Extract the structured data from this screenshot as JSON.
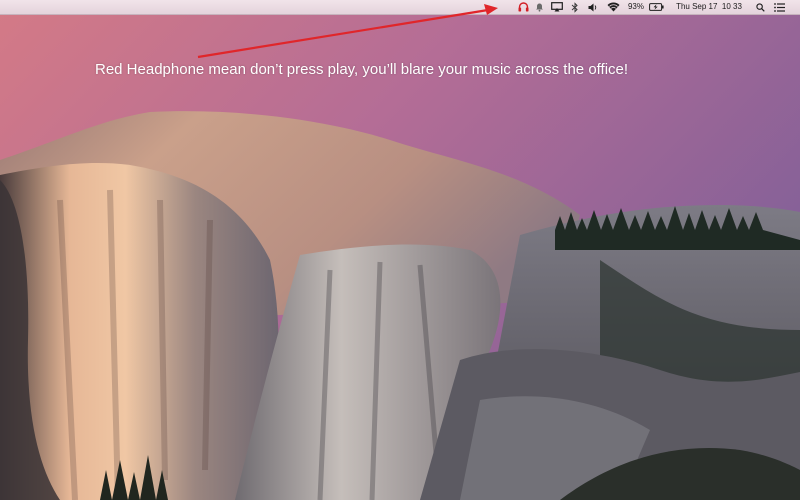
{
  "menubar": {
    "battery_percent": "93%",
    "clock": "Thu Sep 17  10 33",
    "icons": [
      "headphones-icon",
      "notification-bell-icon",
      "airplay-icon",
      "bluetooth-icon",
      "volume-icon",
      "wifi-icon",
      "battery-charging-icon",
      "spotlight-search-icon",
      "notification-center-icon"
    ],
    "headphone_color": "#d21f26"
  },
  "annotation": {
    "text": "Red Headphone mean don’t press play, you’ll blare your music across the office!",
    "arrow_color": "#e0262a",
    "text_color": "#ffffff"
  },
  "wallpaper": {
    "sky_top": "#d47a86",
    "sky_right": "#7f5f98",
    "rock_light": "#e6b796",
    "rock_shadow": "#3c3a3d"
  }
}
